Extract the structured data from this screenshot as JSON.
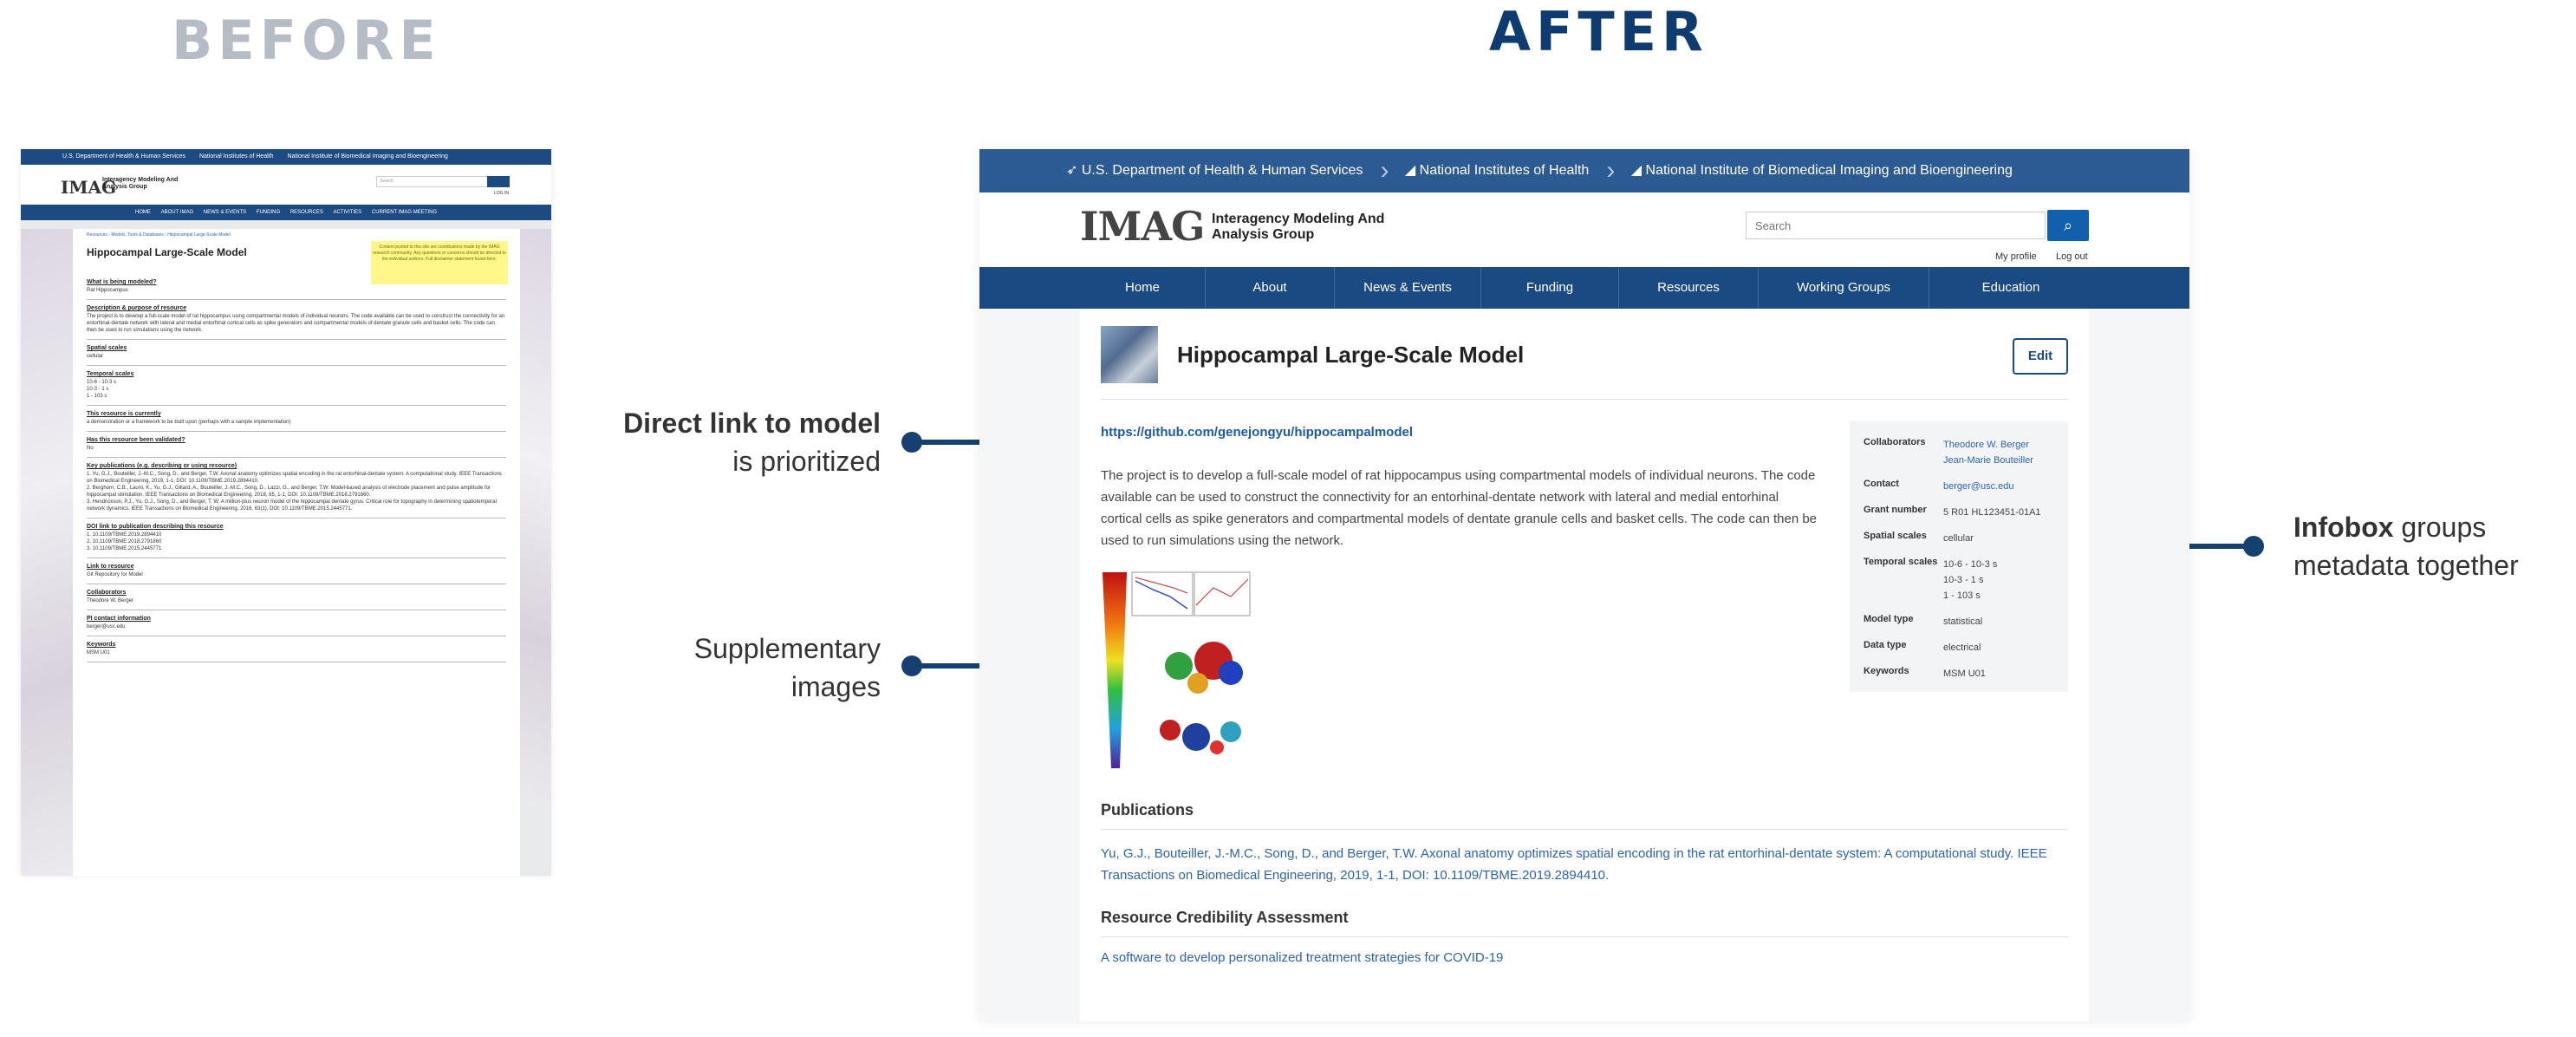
{
  "headings": {
    "before": "BEFORE",
    "after": "AFTER"
  },
  "before": {
    "gov_bar": [
      "U.S. Department of Health & Human Services",
      "National Institutes of Health",
      "National Institute of Biomedical Imaging and Bioengineering"
    ],
    "logo": "IMAG",
    "logo_text_1": "Interagency Modeling And",
    "logo_text_2": "Analysis Group",
    "search_placeholder": "Search",
    "login": "LOG IN",
    "nav": [
      "HOME",
      "ABOUT IMAG",
      "NEWS & EVENTS",
      "FUNDING",
      "RESOURCES",
      "ACTIVITIES",
      "CURRENT IMAG MEETING"
    ],
    "breadcrumb": "Resources › Models, Tools & Databases › Hippocampal Large-Scale Model",
    "title": "Hippocampal Large-Scale Model",
    "note": "Content posted to this site are contributions made by the IMAG research community. Any questions or concerns should be directed to the individual authors. Full disclaimer statement found here.",
    "sections": [
      {
        "q": "What is being modeled?",
        "a": "Rat Hippocampus"
      },
      {
        "q": "Description & purpose of resource",
        "a": "The project is to develop a full-scale model of rat hippocampus using compartmental models of individual neurons. The code available can be used to construct the connectivity for an entorhinal-dentate network with lateral and medial entorhinal cortical cells as spike generators and compartmental models of dentate granule cells and basket cells. The code can then be used to run simulations using the network."
      },
      {
        "q": "Spatial scales",
        "a": "cellular"
      },
      {
        "q": "Temporal scales",
        "a": "10-6 - 10-3 s\n10-3 - 1 s\n1 - 103 s"
      },
      {
        "q": "This resource is currently",
        "a": "a demonstration or a framework to be built upon (perhaps with a sample implementation)"
      },
      {
        "q": "Has this resource been validated?",
        "a": "No"
      },
      {
        "q": "Key publications (e.g. describing or using resource)",
        "a": "1. Yu, G.J., Bouteiller, J.-M.C., Song, D., and Berger, T.W. Axonal anatomy optimizes spatial encoding in the rat entorhinal-dentate system: A computational study. IEEE Transactions on Biomedical Engineering, 2019, 1-1, DOI: 10.1109/TBME.2019.2894410.\n2. Berghorn, C.B., Lauro, K., Yu, G.J., Gillard, A., Bouteiller, J.-M.C., Song, D., Lazzi, G., and Berger, T.W. Model-based analysis of electrode placement and pulse amplitude for hippocampal stimulation. IEEE Transactions on Biomedical Engineering, 2018, 65, 1-1, DOI: 10.1109/TBME.2018.2791860.\n3. Hendrickson, P.J., Yu, G.J., Song, D., and Berger, T. W. A million-plus neuron model of the hippocampal dentate gyrus: Critical role for topography in determining spatiotemporal network dynamics. IEEE Transactions on Biomedical Engineering, 2016, 63(1), DOI: 10.1109/TBME.2015.2445771."
      },
      {
        "q": "DOI link to publication describing this resource",
        "a": "1. 10.1109/TBME.2019.2894410\n2. 10.1109/TBME.2018.2791860\n3. 10.1109/TBME.2015.2445771"
      },
      {
        "q": "Link to resource",
        "a": "Git Repository for Model"
      },
      {
        "q": "Collaborators",
        "a": "Theodore W. Berger"
      },
      {
        "q": "PI contact information",
        "a": "berger@usc.edu"
      },
      {
        "q": "Keywords",
        "a": "MSM U01"
      }
    ]
  },
  "after": {
    "gov_bar": [
      "U.S. Department of Health & Human Services",
      "National Institutes of Health",
      "National Institute of Biomedical Imaging and Bioengineering"
    ],
    "logo": "IMAG",
    "logo_text_1": "Interagency Modeling And",
    "logo_text_2": "Analysis Group",
    "search_placeholder": "Search",
    "search_icon": "search-icon",
    "my_profile": "My profile",
    "log_out": "Log out",
    "nav": [
      "Home",
      "About",
      "News & Events",
      "Funding",
      "Resources",
      "Working Groups",
      "Education"
    ],
    "title": "Hippocampal Large-Scale Model",
    "edit": "Edit",
    "model_link": "https://github.com/genejongyu/hippocampalmodel",
    "description": "The project is to develop a full-scale model of rat hippocampus using compartmental models of individual neurons. The code available can be used to construct the connectivity for an entorhinal-dentate network with lateral and medial entorhinal cortical cells as spike generators and compartmental models of dentate granule cells and basket cells. The code can then be used to run simulations using the network.",
    "infobox": {
      "collaborators_k": "Collaborators",
      "collaborators_v": "Theodore W. Berger\nJean-Marie Bouteiller",
      "contact_k": "Contact",
      "contact_v": "berger@usc.edu",
      "grant_k": "Grant number",
      "grant_v": "5 R01 HL123451-01A1",
      "spatial_k": "Spatial scales",
      "spatial_v": "cellular",
      "temporal_k": "Temporal scales",
      "temporal_v": "10-6 - 10-3 s\n10-3 - 1 s\n1 - 103 s",
      "model_type_k": "Model type",
      "model_type_v": "statistical",
      "data_type_k": "Data type",
      "data_type_v": "electrical",
      "keywords_k": "Keywords",
      "keywords_v": "MSM U01"
    },
    "publications_heading": "Publications",
    "publication": "Yu, G.J., Bouteiller, J.-M.C., Song, D., and Berger, T.W.  Axonal anatomy optimizes spatial encoding in the rat entorhinal-dentate system: A computational study.  IEEE Transactions on Biomedical Engineering, 2019, 1-1, DOI: 10.1109/TBME.2019.2894410.",
    "rca_heading": "Resource Credibility Assessment",
    "rca_link": "A software to develop personalized treatment strategies for COVID-19"
  },
  "callouts": {
    "link_bold": "Direct link to model",
    "link_rest": "is prioritized",
    "images_1": "Supplementary",
    "images_2": "images",
    "infobox_bold": "Infobox",
    "infobox_rest_1": " groups",
    "infobox_rest_2": "metadata together"
  },
  "colors": {
    "navy": "#1b4a82",
    "link": "#2c63b0",
    "callout": "#16406f",
    "before_heading": "#b5bcc6"
  }
}
